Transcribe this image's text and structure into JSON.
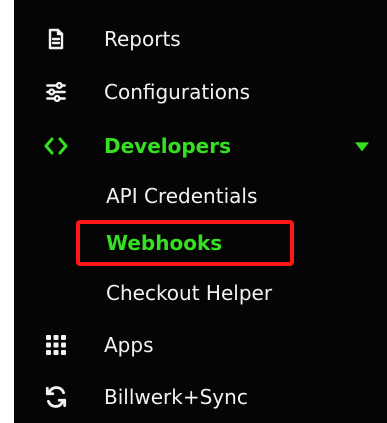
{
  "menu": {
    "items": [
      {
        "label": "Reports",
        "icon": "document-icon"
      },
      {
        "label": "Configurations",
        "icon": "sliders-icon"
      },
      {
        "label": "Developers",
        "icon": "code-icon",
        "active": true
      },
      {
        "label": "Apps",
        "icon": "grid-icon"
      },
      {
        "label": "Billwerk+Sync",
        "icon": "sync-icon"
      }
    ],
    "developer_subitems": [
      {
        "label": "API Credentials"
      },
      {
        "label": "Webhooks",
        "active": true
      },
      {
        "label": "Checkout Helper"
      }
    ]
  },
  "colors": {
    "background": "#050505",
    "text": "#f2f2f2",
    "accent": "#34e020",
    "highlight": "#ff1717"
  }
}
